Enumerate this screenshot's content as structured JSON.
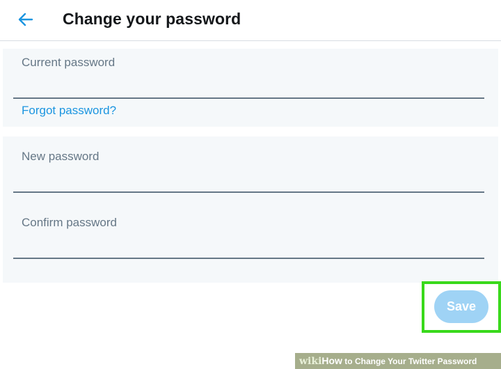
{
  "header": {
    "back_icon": "arrow-left-icon",
    "title": "Change your password"
  },
  "form": {
    "current_password": {
      "label": "Current password",
      "value": ""
    },
    "forgot_link": "Forgot password?",
    "new_password": {
      "label": "New password",
      "value": ""
    },
    "confirm_password": {
      "label": "Confirm password",
      "value": ""
    }
  },
  "actions": {
    "save_label": "Save"
  },
  "watermark": {
    "wiki": "wiki",
    "how": "How",
    "text": " to Change Your Twitter Password"
  },
  "colors": {
    "accent": "#1b95e0",
    "save_button_disabled": "#9fd3f5",
    "highlight": "#39d91b",
    "field_background": "#f5f8fa",
    "title_text": "#14171a",
    "label_text": "#657786"
  }
}
